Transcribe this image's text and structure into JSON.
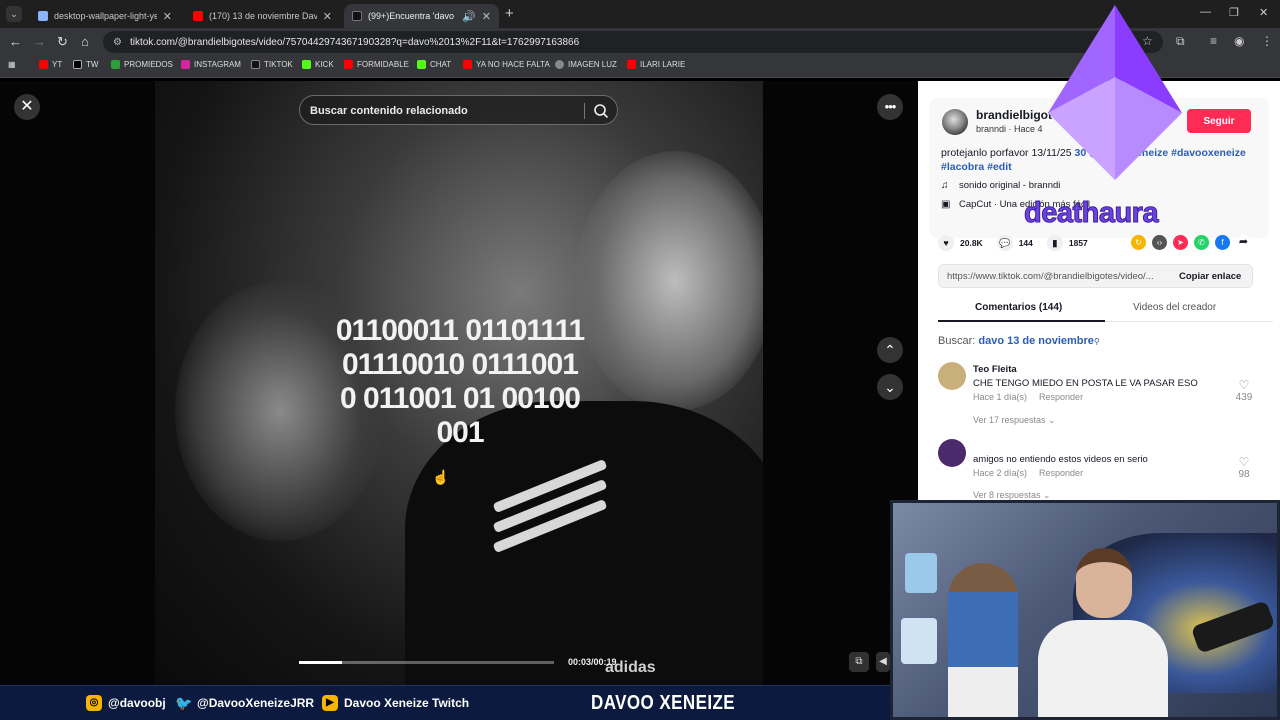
{
  "browser": {
    "tabs": [
      {
        "label": "desktop-wallpaper-light-yellow",
        "fav_color": "#8ab4f8"
      },
      {
        "label": "(170) 13 de noviembre DavoXe",
        "fav_color": "#ff0000"
      },
      {
        "label": "(99+)Encuentra 'davo 13/1",
        "fav_color": "#111111"
      }
    ],
    "url": "tiktok.com/@brandielbigotes/video/7570442974367190328?q=davo%2013%2F11&t=1762997163866",
    "bookmarks": [
      {
        "label": "YT",
        "color": "#ff0000"
      },
      {
        "label": "TW",
        "color": "#000000"
      },
      {
        "label": "PROMIEDOS",
        "color": "#2e9e3a"
      },
      {
        "label": "INSTAGRAM",
        "color": "#d6249f"
      },
      {
        "label": "TIKTOK",
        "color": "#111111"
      },
      {
        "label": "KICK",
        "color": "#53fc18"
      },
      {
        "label": "FORMIDABLE",
        "color": "#ff0000"
      },
      {
        "label": "CHAT",
        "color": "#53fc18"
      },
      {
        "label": "YA NO HACE FALTA",
        "color": "#ff0000"
      },
      {
        "label": "IMAGEN LUZ",
        "color": "#888888"
      },
      {
        "label": "ILARI LARIE",
        "color": "#ff0000"
      }
    ]
  },
  "video": {
    "search_placeholder": "Buscar contenido relacionado",
    "overlay_text": "01100011 01101111 01110010 01110010 011001 01 00100001",
    "brand_text": "adidas",
    "progress": 0.17,
    "time": "00:03/00:19"
  },
  "panel": {
    "username": "brandielbigotes",
    "subline": "branndi · Hace 4",
    "follow_label": "Seguir",
    "description_text": "protejanlo porfavor 13/11/25",
    "description_tags": "30 @davooxeneize #davooxeneize #lacobra #edit",
    "sound": "sonido original - branndi",
    "capcut": "CapCut · Una edición más fácil",
    "stats": {
      "likes": "20.8K",
      "comments": "144",
      "saves": "1857"
    },
    "share_colors": [
      "#f7b500",
      "#555555",
      "#fe2c55",
      "#25d366",
      "#1877f2",
      "#161823"
    ],
    "link_url": "https://www.tiktok.com/@brandielbigotes/video/...",
    "copy_label": "Copiar enlace",
    "tab_comments": "Comentarios (144)",
    "tab_creator": "Videos del creador",
    "search_prefix": "Buscar:",
    "search_query": "davo 13 de noviembre",
    "comments": [
      {
        "name": "Teo Fleita",
        "text": "CHE TENGO MIEDO EN POSTA LE VA PASAR ESO",
        "time": "Hace 1 día(s)",
        "reply": "Responder",
        "likes": "439",
        "replies": "Ver 17 respuestas",
        "avatar_color": "#c9b07a"
      },
      {
        "name": "",
        "text": "amigos no entiendo estos videos en serio",
        "time": "Hace 2 día(s)",
        "reply": "Responder",
        "likes": "98",
        "replies": "Ver 8 respuestas",
        "avatar_color": "#4a2a6a"
      }
    ]
  },
  "overlay": {
    "logo_word": "deathaura",
    "logo_color": "#8a4dff"
  },
  "banner": {
    "instagram": "@davoobj",
    "twitter": "@DavooXeneizeJRR",
    "youtube": "Davoo Xeneize Twitch",
    "title": "DAVOO XENEIZE"
  }
}
